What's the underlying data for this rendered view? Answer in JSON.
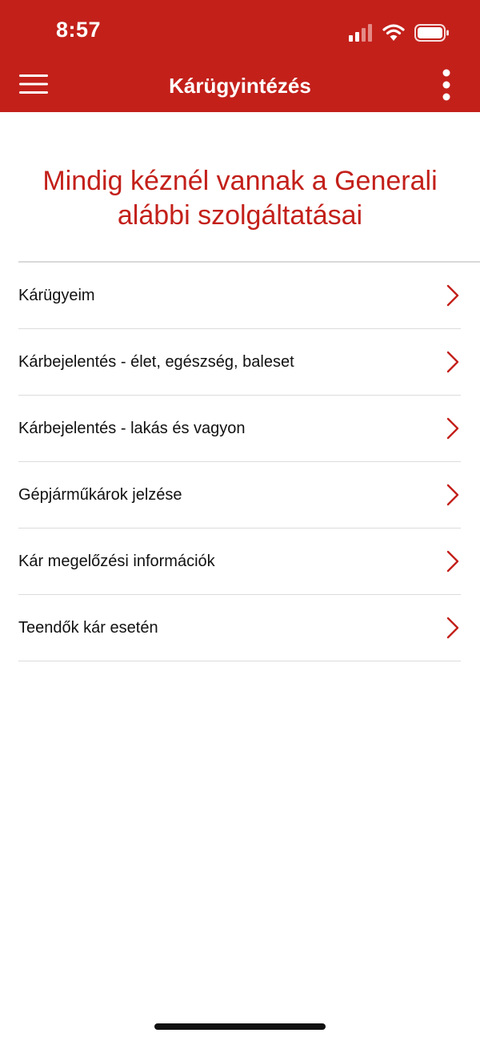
{
  "status_bar": {
    "time": "8:57",
    "icons": [
      "signal-icon",
      "wifi-icon",
      "battery-icon"
    ]
  },
  "nav_bar": {
    "title": "Kárügyintézés",
    "left_icon": "hamburger-menu-icon",
    "right_icon": "more-vertical-icon"
  },
  "headline": {
    "line1": "Mindig kéznél vannak a Generali",
    "line2": "alábbi szolgáltatásai"
  },
  "menu": {
    "items": [
      {
        "label": "Kárügyeim"
      },
      {
        "label": "Kárbejelentés - élet, egészség, baleset"
      },
      {
        "label": "Kárbejelentés - lakás és vagyon"
      },
      {
        "label": "Gépjárműkárok jelzése"
      },
      {
        "label": "Kár megelőzési információk"
      },
      {
        "label": "Teendők kár esetén"
      }
    ],
    "chevron_icon": "chevron-right-icon"
  },
  "colors": {
    "brand_red": "#c3201a",
    "text": "#111111",
    "divider": "#dcdcdc",
    "background": "#ffffff"
  }
}
